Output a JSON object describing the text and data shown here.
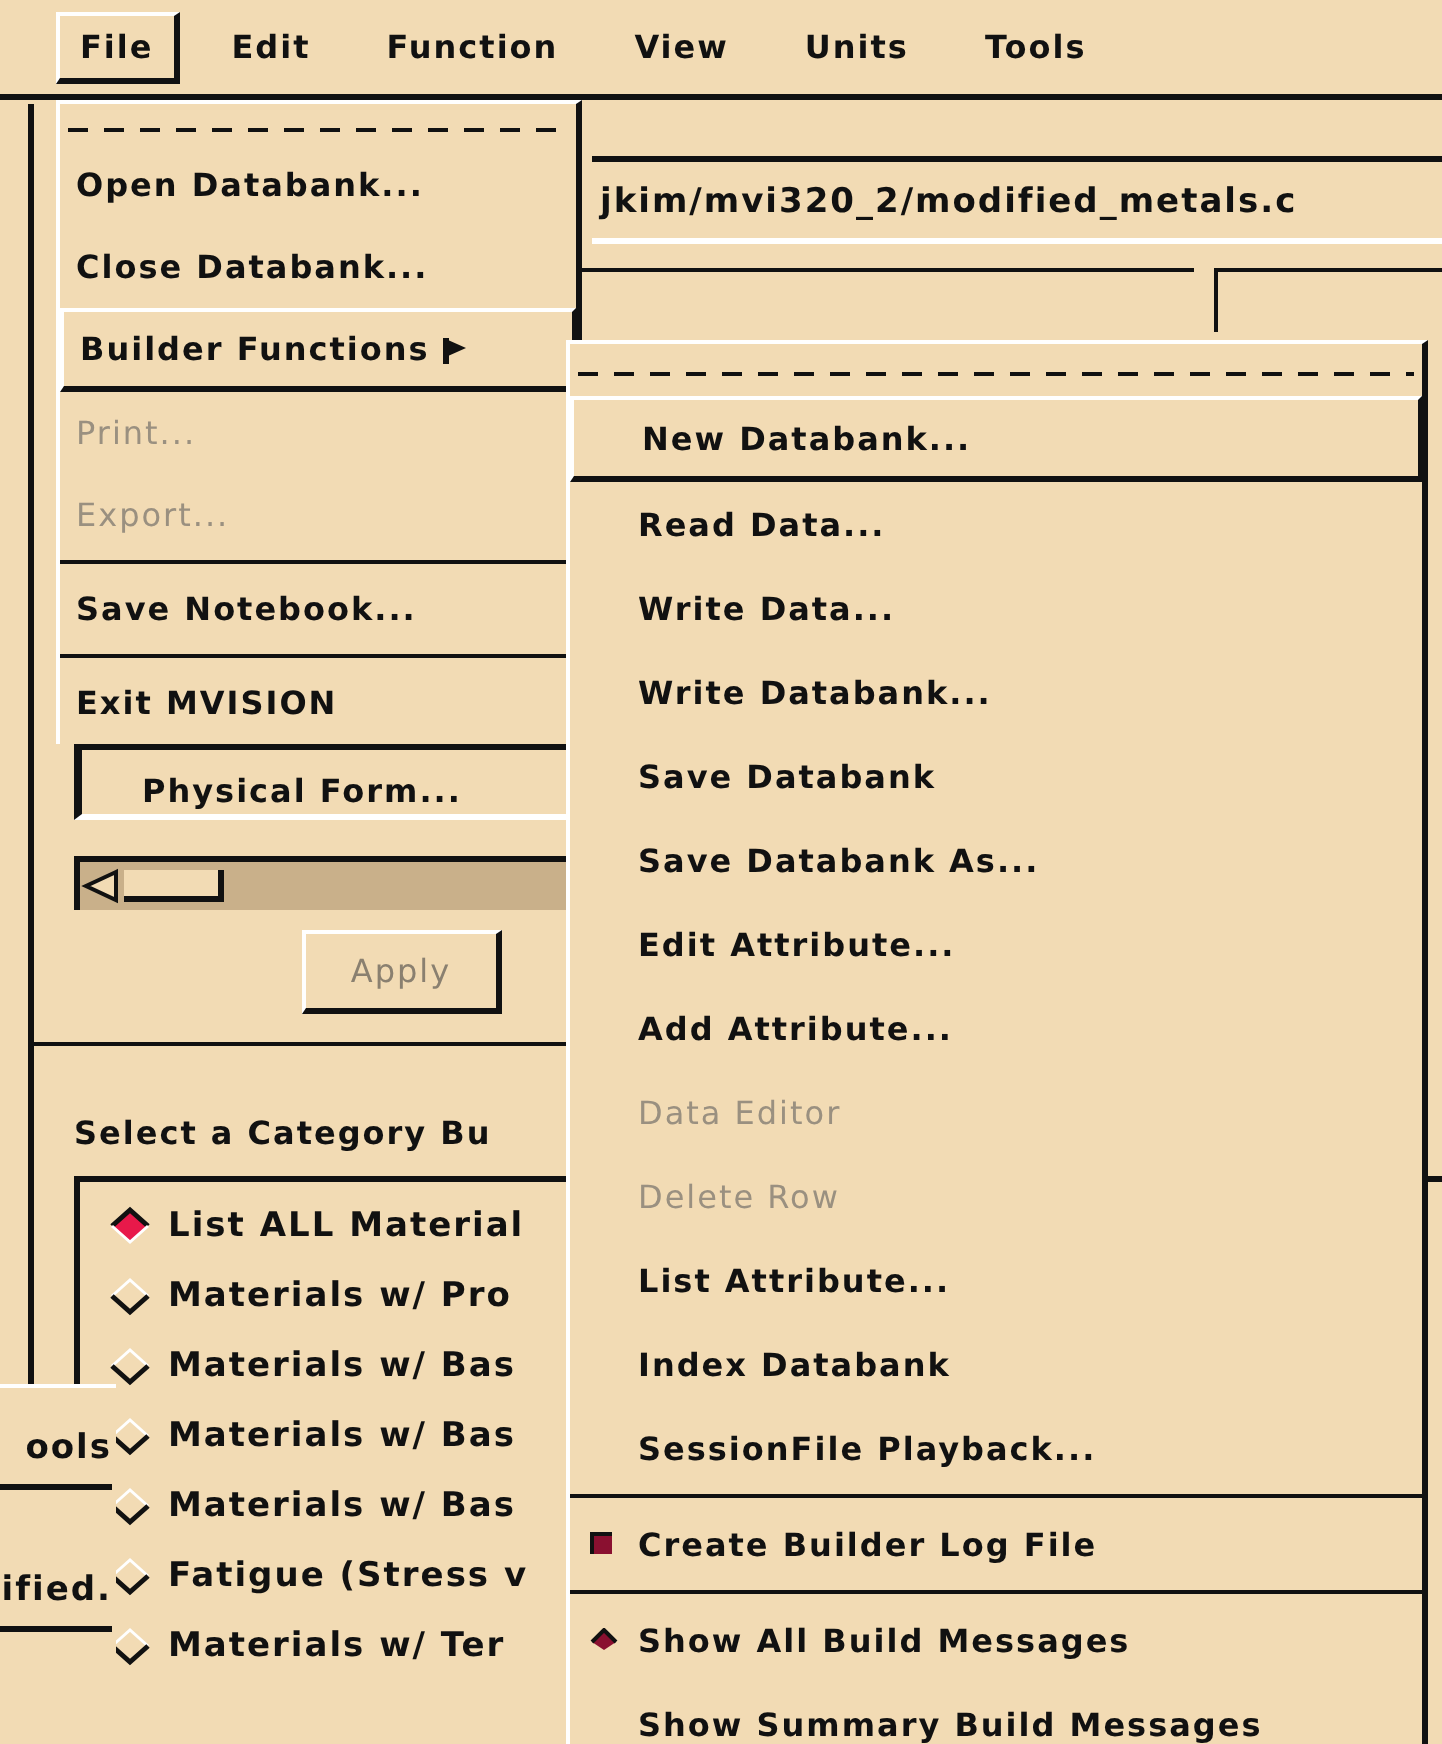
{
  "menubar": [
    {
      "label": "File",
      "selected": true
    },
    {
      "label": "Edit",
      "selected": false
    },
    {
      "label": "Function",
      "selected": false
    },
    {
      "label": "View",
      "selected": false
    },
    {
      "label": "Units",
      "selected": false
    },
    {
      "label": "Tools",
      "selected": false
    }
  ],
  "main_window": {
    "path": "jkim/mvi320_2/modified_metals.c",
    "physical_form_button": "Physical Form...",
    "apply_button": {
      "label": "Apply",
      "disabled": true
    },
    "category_heading": "Select a Category Bu",
    "categories": [
      {
        "label": "List ALL Material",
        "selected": true
      },
      {
        "label": "Materials w/ Pro",
        "selected": false
      },
      {
        "label": "Materials w/ Bas",
        "selected": false
      },
      {
        "label": "Materials w/ Bas",
        "selected": false
      },
      {
        "label": "Materials w/ Bas",
        "selected": false
      },
      {
        "label": "Fatigue (Stress v",
        "selected": false
      },
      {
        "label": "Materials w/ Ter",
        "selected": false
      }
    ]
  },
  "back_window": {
    "texts": [
      "ools",
      "ified."
    ]
  },
  "file_menu": {
    "items": [
      {
        "kind": "tearoff"
      },
      {
        "kind": "item",
        "label": "Open Databank...",
        "disabled": false
      },
      {
        "kind": "item",
        "label": "Close Databank...",
        "disabled": false
      },
      {
        "kind": "cascade",
        "label": "Builder Functions",
        "highlighted": true
      },
      {
        "kind": "item",
        "label": "Print...",
        "disabled": true
      },
      {
        "kind": "item",
        "label": "Export...",
        "disabled": true
      },
      {
        "kind": "separator"
      },
      {
        "kind": "item",
        "label": "Save Notebook...",
        "disabled": false
      },
      {
        "kind": "separator"
      },
      {
        "kind": "item",
        "label": "Exit MVISION",
        "disabled": false
      }
    ]
  },
  "builder_menu": {
    "items": [
      {
        "kind": "tearoff"
      },
      {
        "kind": "item",
        "label": "New Databank...",
        "disabled": false,
        "highlighted": true
      },
      {
        "kind": "item",
        "label": "Read Data...",
        "disabled": false,
        "highlighted": false
      },
      {
        "kind": "item",
        "label": "Write Data...",
        "disabled": false,
        "highlighted": false
      },
      {
        "kind": "item",
        "label": "Write Databank...",
        "disabled": false,
        "highlighted": false
      },
      {
        "kind": "item",
        "label": "Save Databank",
        "disabled": false,
        "highlighted": false
      },
      {
        "kind": "item",
        "label": "Save Databank As...",
        "disabled": false,
        "highlighted": false
      },
      {
        "kind": "item",
        "label": "Edit Attribute...",
        "disabled": false,
        "highlighted": false
      },
      {
        "kind": "item",
        "label": "Add Attribute...",
        "disabled": false,
        "highlighted": false
      },
      {
        "kind": "item",
        "label": "Data Editor",
        "disabled": true,
        "highlighted": false
      },
      {
        "kind": "item",
        "label": "Delete Row",
        "disabled": true,
        "highlighted": false
      },
      {
        "kind": "item",
        "label": "List Attribute...",
        "disabled": false,
        "highlighted": false
      },
      {
        "kind": "item",
        "label": "Index Databank",
        "disabled": false,
        "highlighted": false
      },
      {
        "kind": "item",
        "label": "SessionFile Playback...",
        "disabled": false,
        "highlighted": false
      },
      {
        "kind": "separator"
      },
      {
        "kind": "toggle",
        "label": "Create Builder Log File",
        "checked": true
      },
      {
        "kind": "separator"
      },
      {
        "kind": "radio",
        "label": "Show All Build Messages",
        "selected": true
      },
      {
        "kind": "radio",
        "label": "Show Summary Build Messages",
        "selected": false
      }
    ]
  }
}
